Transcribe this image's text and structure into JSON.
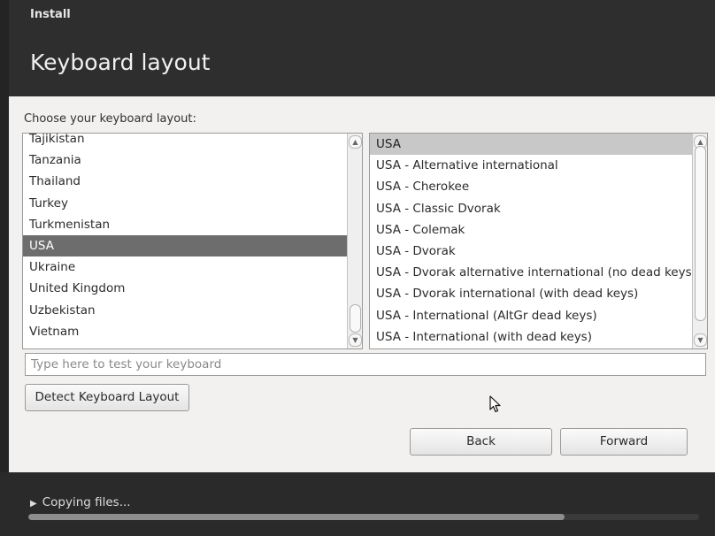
{
  "window": {
    "title": "Install"
  },
  "page": {
    "title": "Keyboard layout",
    "prompt": "Choose your keyboard layout:"
  },
  "countries": {
    "items": [
      "Tajikistan",
      "Tanzania",
      "Thailand",
      "Turkey",
      "Turkmenistan",
      "USA",
      "Ukraine",
      "United Kingdom",
      "Uzbekistan",
      "Vietnam"
    ],
    "selected": "USA"
  },
  "variants": {
    "items": [
      "USA",
      "USA - Alternative international",
      "USA - Cherokee",
      "USA - Classic Dvorak",
      "USA - Colemak",
      "USA - Dvorak",
      "USA - Dvorak alternative international (no dead keys)",
      "USA - Dvorak international (with dead keys)",
      "USA - International (AltGr dead keys)",
      "USA - International (with dead keys)"
    ],
    "selected": "USA"
  },
  "test_field": {
    "placeholder": "Type here to test your keyboard",
    "value": ""
  },
  "buttons": {
    "detect": "Detect Keyboard Layout",
    "back": "Back",
    "forward": "Forward"
  },
  "footer": {
    "status": "Copying files...",
    "progress": 0.8
  },
  "icons": {
    "status": "triangle-right-icon",
    "cursor": "mouse-pointer-icon"
  }
}
